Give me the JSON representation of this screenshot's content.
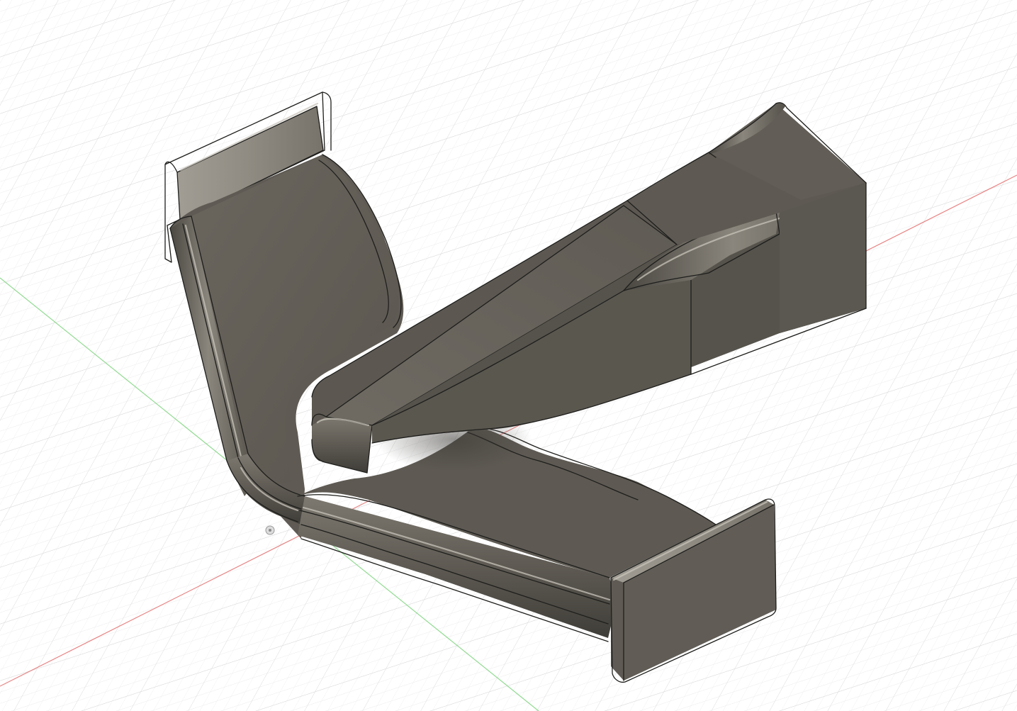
{
  "viewport": {
    "background_color": "#ffffff",
    "grid_minor_color": "#ececec",
    "grid_major_color": "#d6d6d6",
    "x_axis_color": "#e05a5a",
    "y_axis_color": "#6ccf6c"
  },
  "model": {
    "part": "front-wing",
    "body_color": "#5f5b54",
    "body_dark_color": "#4d4a44",
    "body_light_color": "#77736b",
    "highlight_color": "#bdb8ae",
    "edge_color": "#1e1e1c"
  },
  "origin_marker": {
    "icon": "origin-point-icon"
  }
}
